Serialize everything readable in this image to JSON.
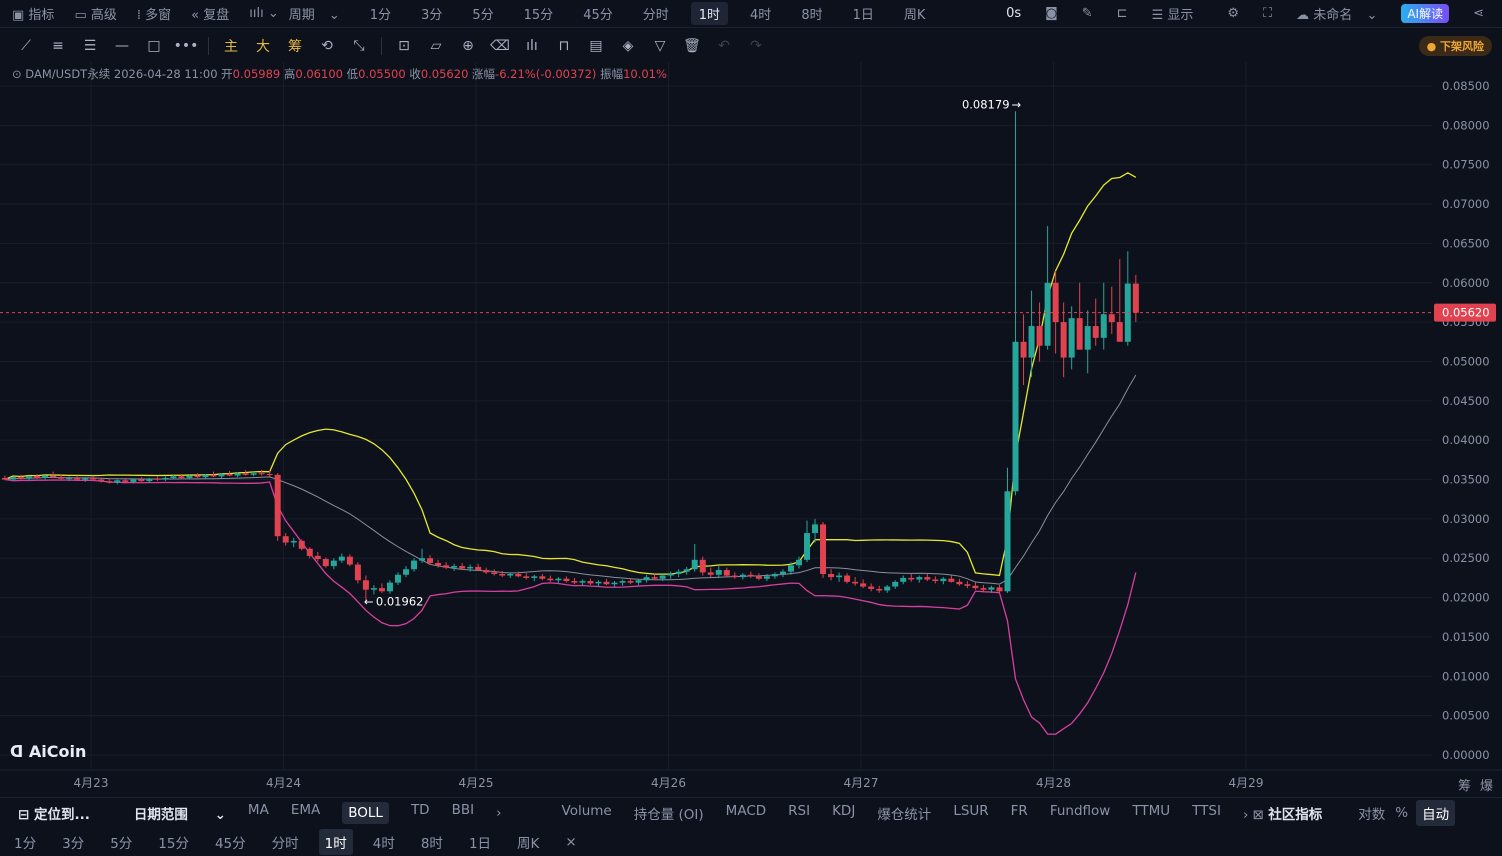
{
  "topbar": {
    "items": [
      "指标",
      "高级",
      "多窗",
      "复盘"
    ],
    "period_label": "周期",
    "timeframes": [
      "1分",
      "3分",
      "5分",
      "15分",
      "45分",
      "分时",
      "1时",
      "4时",
      "8时",
      "1日",
      "周K"
    ],
    "active_timeframe": "1时",
    "countdown": "0s",
    "display_label": "显示",
    "layout_name": "未命名",
    "ai_label": "AI解读"
  },
  "toolbar": {
    "main": "主",
    "big": "大",
    "chip": "筹",
    "risk_badge": "下架风险"
  },
  "info": {
    "pair": "DAM/USDT永续",
    "time": "2026-04-28 11:00",
    "open_label": "开",
    "open": "0.05989",
    "high_label": "高",
    "high": "0.06100",
    "low_label": "低",
    "low": "0.05500",
    "close_label": "收",
    "close": "0.05620",
    "change_label": "涨幅",
    "change": "-6.21%(-0.00372)",
    "amp_label": "振幅",
    "amp": "10.01%"
  },
  "logo": "AiCoin",
  "chart_data": {
    "type": "candlestick",
    "indicator": "BOLL",
    "start": "4月22 14:00",
    "interval": "1h",
    "yticks": [
      "0.08500",
      "0.08000",
      "0.07500",
      "0.07000",
      "0.06500",
      "0.06000",
      "0.05500",
      "0.05000",
      "0.04500",
      "0.04000",
      "0.03500",
      "0.03000",
      "0.02500",
      "0.02000",
      "0.01500",
      "0.01000",
      "0.00500",
      "0.00000"
    ],
    "ylim": [
      0,
      0.085
    ],
    "xticks": [
      "4月23",
      "4月24",
      "4月25",
      "4月26",
      "4月27",
      "4月28",
      "4月29"
    ],
    "last_price": "0.05620",
    "max_label": "0.08179",
    "min_label": "0.01962",
    "axis_corner": [
      "筹",
      "爆"
    ],
    "candles": [
      [
        0.0352,
        0.0355,
        0.0349,
        0.035
      ],
      [
        0.035,
        0.0354,
        0.0348,
        0.0353
      ],
      [
        0.0353,
        0.0356,
        0.035,
        0.0351
      ],
      [
        0.0351,
        0.0355,
        0.0349,
        0.0354
      ],
      [
        0.0354,
        0.0357,
        0.0351,
        0.0352
      ],
      [
        0.0352,
        0.0356,
        0.035,
        0.0355
      ],
      [
        0.0355,
        0.036,
        0.0352,
        0.0353
      ],
      [
        0.0353,
        0.0356,
        0.035,
        0.0351
      ],
      [
        0.0351,
        0.0354,
        0.0348,
        0.0352
      ],
      [
        0.0352,
        0.0355,
        0.0349,
        0.035
      ],
      [
        0.035,
        0.0353,
        0.0347,
        0.0352
      ],
      [
        0.0352,
        0.0355,
        0.0349,
        0.035
      ],
      [
        0.035,
        0.0352,
        0.0346,
        0.0348
      ],
      [
        0.0348,
        0.0351,
        0.0345,
        0.0346
      ],
      [
        0.0346,
        0.035,
        0.0344,
        0.0349
      ],
      [
        0.0349,
        0.0352,
        0.0346,
        0.0347
      ],
      [
        0.0347,
        0.0351,
        0.0345,
        0.035
      ],
      [
        0.035,
        0.0353,
        0.0347,
        0.0348
      ],
      [
        0.0348,
        0.0352,
        0.0346,
        0.0351
      ],
      [
        0.0351,
        0.0354,
        0.0348,
        0.035
      ],
      [
        0.035,
        0.0354,
        0.0348,
        0.0352
      ],
      [
        0.0352,
        0.0356,
        0.035,
        0.0354
      ],
      [
        0.0354,
        0.0357,
        0.0351,
        0.0352
      ],
      [
        0.0352,
        0.0356,
        0.035,
        0.0355
      ],
      [
        0.0355,
        0.0358,
        0.0352,
        0.0353
      ],
      [
        0.0353,
        0.0357,
        0.0351,
        0.0356
      ],
      [
        0.0356,
        0.036,
        0.0353,
        0.0354
      ],
      [
        0.0354,
        0.0358,
        0.0352,
        0.0357
      ],
      [
        0.0357,
        0.0361,
        0.0354,
        0.0355
      ],
      [
        0.0355,
        0.0359,
        0.0353,
        0.0358
      ],
      [
        0.0358,
        0.0362,
        0.0355,
        0.0356
      ],
      [
        0.0356,
        0.036,
        0.0354,
        0.0358
      ],
      [
        0.0358,
        0.0362,
        0.0355,
        0.0357
      ],
      [
        0.0357,
        0.0362,
        0.0354,
        0.0356
      ],
      [
        0.0356,
        0.0358,
        0.0272,
        0.0278
      ],
      [
        0.0278,
        0.0282,
        0.0266,
        0.027
      ],
      [
        0.027,
        0.0276,
        0.0264,
        0.0272
      ],
      [
        0.0272,
        0.0274,
        0.026,
        0.0262
      ],
      [
        0.0262,
        0.0264,
        0.025,
        0.0253
      ],
      [
        0.0253,
        0.0258,
        0.0246,
        0.0249
      ],
      [
        0.0249,
        0.0251,
        0.0238,
        0.024
      ],
      [
        0.024,
        0.025,
        0.0236,
        0.0247
      ],
      [
        0.0247,
        0.0256,
        0.0244,
        0.0252
      ],
      [
        0.0252,
        0.0255,
        0.024,
        0.0242
      ],
      [
        0.0242,
        0.0245,
        0.0218,
        0.0222
      ],
      [
        0.0222,
        0.0228,
        0.01962,
        0.021
      ],
      [
        0.021,
        0.0216,
        0.0204,
        0.0212
      ],
      [
        0.0212,
        0.0218,
        0.0206,
        0.0208
      ],
      [
        0.0208,
        0.0222,
        0.0205,
        0.0219
      ],
      [
        0.0219,
        0.0232,
        0.0216,
        0.0229
      ],
      [
        0.0229,
        0.024,
        0.0226,
        0.0236
      ],
      [
        0.0236,
        0.025,
        0.0233,
        0.0247
      ],
      [
        0.0247,
        0.0262,
        0.0244,
        0.025
      ],
      [
        0.025,
        0.0254,
        0.0242,
        0.0244
      ],
      [
        0.0244,
        0.0248,
        0.0238,
        0.0241
      ],
      [
        0.0241,
        0.0245,
        0.0236,
        0.0238
      ],
      [
        0.0238,
        0.0243,
        0.0234,
        0.024
      ],
      [
        0.024,
        0.0244,
        0.0235,
        0.0237
      ],
      [
        0.0237,
        0.0242,
        0.0233,
        0.0239
      ],
      [
        0.0239,
        0.0243,
        0.0234,
        0.0235
      ],
      [
        0.0235,
        0.0238,
        0.023,
        0.0232
      ],
      [
        0.0232,
        0.0236,
        0.0228,
        0.023
      ],
      [
        0.023,
        0.0234,
        0.0226,
        0.0228
      ],
      [
        0.0228,
        0.0232,
        0.0225,
        0.023
      ],
      [
        0.023,
        0.0233,
        0.0226,
        0.0227
      ],
      [
        0.0227,
        0.0231,
        0.0223,
        0.0225
      ],
      [
        0.0225,
        0.0229,
        0.0221,
        0.0227
      ],
      [
        0.0227,
        0.023,
        0.0222,
        0.0224
      ],
      [
        0.0224,
        0.0228,
        0.022,
        0.0222
      ],
      [
        0.0222,
        0.0226,
        0.0218,
        0.0224
      ],
      [
        0.0224,
        0.0227,
        0.0219,
        0.0221
      ],
      [
        0.0221,
        0.0225,
        0.0217,
        0.0219
      ],
      [
        0.0219,
        0.0223,
        0.0215,
        0.0221
      ],
      [
        0.0221,
        0.0224,
        0.0216,
        0.0218
      ],
      [
        0.0218,
        0.0222,
        0.0214,
        0.022
      ],
      [
        0.022,
        0.0224,
        0.0216,
        0.0217
      ],
      [
        0.0217,
        0.0221,
        0.0213,
        0.0219
      ],
      [
        0.0219,
        0.0223,
        0.0215,
        0.0221
      ],
      [
        0.0221,
        0.0225,
        0.0217,
        0.0219
      ],
      [
        0.0219,
        0.0224,
        0.0216,
        0.0222
      ],
      [
        0.0222,
        0.0229,
        0.0219,
        0.0226
      ],
      [
        0.0226,
        0.023,
        0.0222,
        0.0224
      ],
      [
        0.0224,
        0.0231,
        0.0221,
        0.0228
      ],
      [
        0.0228,
        0.0233,
        0.0224,
        0.023
      ],
      [
        0.023,
        0.0236,
        0.0226,
        0.0233
      ],
      [
        0.0233,
        0.0239,
        0.0229,
        0.0236
      ],
      [
        0.0236,
        0.0268,
        0.0233,
        0.0248
      ],
      [
        0.0248,
        0.0252,
        0.0228,
        0.0232
      ],
      [
        0.0232,
        0.0238,
        0.0226,
        0.0229
      ],
      [
        0.0229,
        0.024,
        0.0225,
        0.0235
      ],
      [
        0.0235,
        0.0238,
        0.0226,
        0.0228
      ],
      [
        0.0228,
        0.0232,
        0.0224,
        0.0226
      ],
      [
        0.0226,
        0.0231,
        0.0223,
        0.0229
      ],
      [
        0.0229,
        0.0233,
        0.0225,
        0.0227
      ],
      [
        0.0227,
        0.0231,
        0.0222,
        0.0224
      ],
      [
        0.0224,
        0.023,
        0.0221,
        0.0227
      ],
      [
        0.0227,
        0.0232,
        0.0224,
        0.023
      ],
      [
        0.023,
        0.0236,
        0.0226,
        0.0233
      ],
      [
        0.0233,
        0.0245,
        0.0229,
        0.0241
      ],
      [
        0.0241,
        0.0252,
        0.0237,
        0.0248
      ],
      [
        0.0248,
        0.0298,
        0.0245,
        0.0282
      ],
      [
        0.0282,
        0.03,
        0.027,
        0.0293
      ],
      [
        0.0293,
        0.0296,
        0.0225,
        0.023
      ],
      [
        0.023,
        0.0236,
        0.0222,
        0.0226
      ],
      [
        0.0226,
        0.0232,
        0.022,
        0.0228
      ],
      [
        0.0228,
        0.0231,
        0.0218,
        0.022
      ],
      [
        0.022,
        0.0226,
        0.0215,
        0.0218
      ],
      [
        0.0218,
        0.0223,
        0.0212,
        0.0214
      ],
      [
        0.0214,
        0.0218,
        0.0208,
        0.0211
      ],
      [
        0.0211,
        0.0215,
        0.0206,
        0.0209
      ],
      [
        0.0209,
        0.0216,
        0.0206,
        0.0214
      ],
      [
        0.0214,
        0.0222,
        0.0211,
        0.022
      ],
      [
        0.022,
        0.0228,
        0.0217,
        0.0225
      ],
      [
        0.0225,
        0.023,
        0.022,
        0.0223
      ],
      [
        0.0223,
        0.0228,
        0.0219,
        0.0226
      ],
      [
        0.0226,
        0.023,
        0.0221,
        0.0223
      ],
      [
        0.0223,
        0.0227,
        0.0218,
        0.0221
      ],
      [
        0.0221,
        0.0226,
        0.0217,
        0.0224
      ],
      [
        0.0224,
        0.0228,
        0.0219,
        0.022
      ],
      [
        0.022,
        0.0224,
        0.0215,
        0.0217
      ],
      [
        0.0217,
        0.0221,
        0.0212,
        0.0215
      ],
      [
        0.0215,
        0.0219,
        0.021,
        0.0212
      ],
      [
        0.0212,
        0.0216,
        0.0207,
        0.021
      ],
      [
        0.021,
        0.0215,
        0.0206,
        0.0213
      ],
      [
        0.0213,
        0.0216,
        0.0205,
        0.0208
      ],
      [
        0.0208,
        0.0365,
        0.0206,
        0.0335
      ],
      [
        0.0335,
        0.08179,
        0.033,
        0.0525
      ],
      [
        0.0525,
        0.056,
        0.047,
        0.0505
      ],
      [
        0.0505,
        0.059,
        0.048,
        0.0545
      ],
      [
        0.0545,
        0.0575,
        0.05,
        0.052
      ],
      [
        0.052,
        0.0672,
        0.0515,
        0.06
      ],
      [
        0.06,
        0.0615,
        0.051,
        0.055
      ],
      [
        0.055,
        0.0575,
        0.048,
        0.0505
      ],
      [
        0.0505,
        0.057,
        0.049,
        0.0555
      ],
      [
        0.0555,
        0.06,
        0.052,
        0.0515
      ],
      [
        0.0515,
        0.0565,
        0.0485,
        0.0545
      ],
      [
        0.0545,
        0.058,
        0.052,
        0.053
      ],
      [
        0.053,
        0.06,
        0.0515,
        0.056
      ],
      [
        0.056,
        0.0595,
        0.0535,
        0.055
      ],
      [
        0.055,
        0.063,
        0.053,
        0.0525
      ],
      [
        0.0525,
        0.064,
        0.052,
        0.0599
      ],
      [
        0.05989,
        0.061,
        0.055,
        0.0562
      ]
    ],
    "colors": {
      "up": "#26a69a",
      "down": "#e0434f",
      "upper": "#e6e62e",
      "mid": "#8a8f9c",
      "lower": "#d63fa0"
    }
  },
  "bottom": {
    "locate": "定位到...",
    "date_range": "日期范围",
    "main_indicators": [
      "MA",
      "EMA",
      "BOLL",
      "TD",
      "BBI"
    ],
    "active_main": "BOLL",
    "sub_indicators": [
      "Volume",
      "持仓量 (OI)",
      "MACD",
      "RSI",
      "KDJ",
      "爆仓统计",
      "LSUR",
      "FR",
      "Fundflow",
      "TTMU",
      "TTSI"
    ],
    "community": "社区指标",
    "log": "对数",
    "percent": "%",
    "auto": "自动",
    "timeframes": [
      "1分",
      "3分",
      "5分",
      "15分",
      "45分",
      "分时",
      "1时",
      "4时",
      "8时",
      "1日",
      "周K"
    ],
    "close": "×"
  }
}
